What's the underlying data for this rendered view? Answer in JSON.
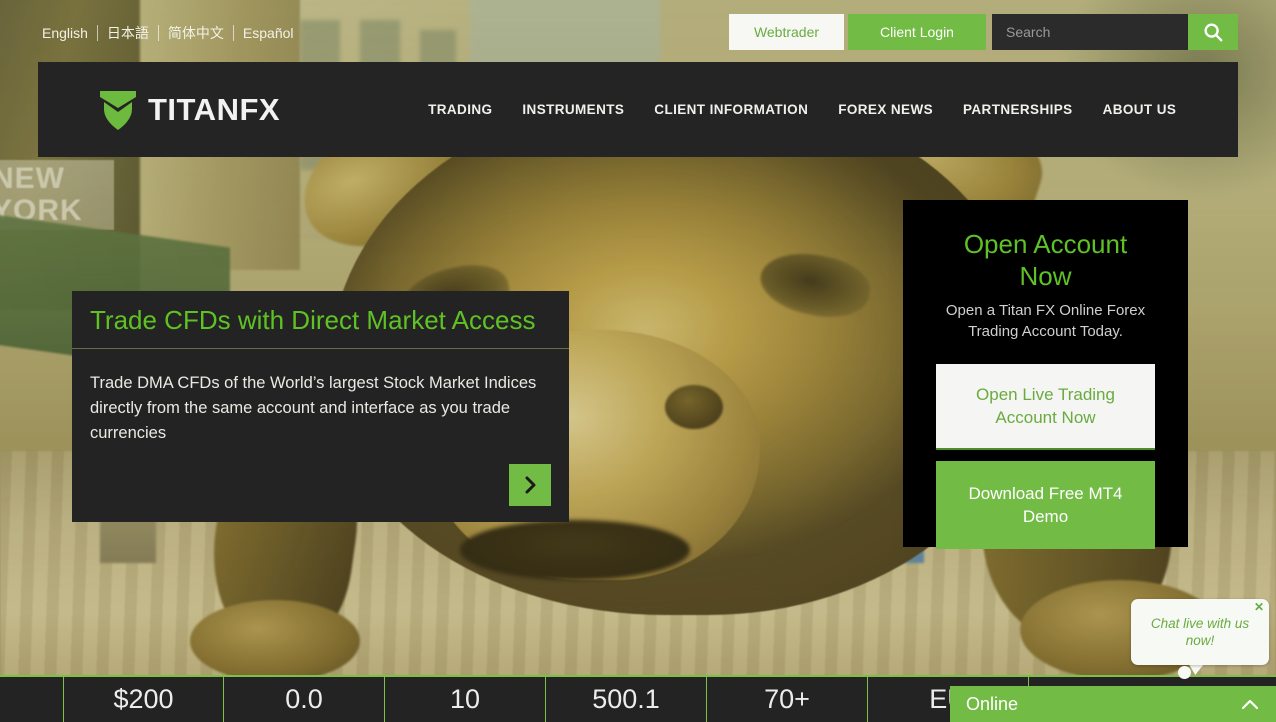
{
  "languages": [
    {
      "label": "English"
    },
    {
      "label": "日本語"
    },
    {
      "label": "简体中文"
    },
    {
      "label": "Español"
    }
  ],
  "top_actions": {
    "webtrader_label": "Webtrader",
    "client_login_label": "Client Login",
    "search_placeholder": "Search",
    "search_value": "",
    "search_icon": "search-icon"
  },
  "brand": {
    "name": "TITAN",
    "suffix": "FX",
    "logo_icon": "titan-shield-icon"
  },
  "nav": {
    "items": [
      {
        "label": "TRADING"
      },
      {
        "label": "INSTRUMENTS"
      },
      {
        "label": "CLIENT INFORMATION"
      },
      {
        "label": "FOREX NEWS"
      },
      {
        "label": "PARTNERSHIPS"
      },
      {
        "label": "ABOUT US"
      }
    ]
  },
  "hero": {
    "title": "Trade CFDs with Direct Market Access",
    "description": "Trade DMA CFDs of the World’s largest Stock Market Indices directly from the same account and interface as you trade currencies",
    "next_arrow_icon": "chevron-right-icon",
    "background_sign_text": "NEW YORK"
  },
  "account_panel": {
    "title": "Open Account Now",
    "subtitle": "Open a Titan FX Online Forex Trading Account Today.",
    "live_button_label": "Open Live Trading Account Now",
    "demo_button_label": "Download Free MT4 Demo"
  },
  "stats": [
    {
      "value": "$200"
    },
    {
      "value": "0.0"
    },
    {
      "value": "10"
    },
    {
      "value": "500.1"
    },
    {
      "value": "70+"
    },
    {
      "value": "EU"
    }
  ],
  "chat": {
    "bubble_text": "Chat live with us now!",
    "close_icon": "close-icon",
    "status_label": "Online",
    "chevron_icon": "chevron-up-icon"
  },
  "colors": {
    "green": "#72bb44",
    "bright_green": "#5fc224",
    "dark": "#232323",
    "black": "#000000"
  }
}
